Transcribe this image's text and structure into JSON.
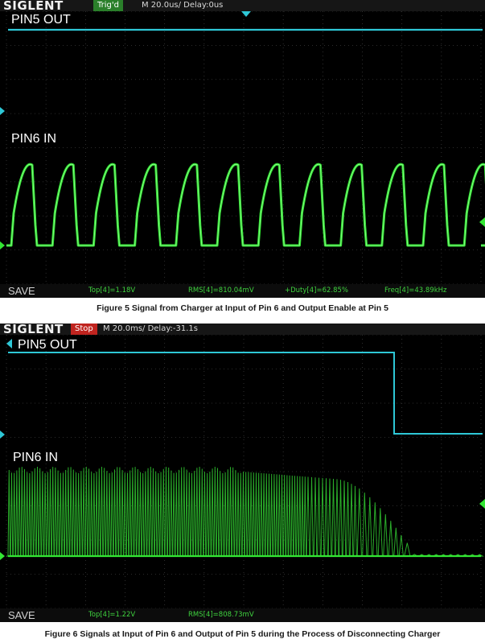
{
  "figure1": {
    "brand": "SIGLENT",
    "status": "Trig'd",
    "timebase": "M 20.0us/  Delay:0us",
    "ch_top_label": "PIN5 OUT",
    "ch_bottom_label": "PIN6 IN",
    "save_label": "SAVE",
    "measurements": {
      "top": "Top[4]=1.18V",
      "rms": "RMS[4]=810.04mV",
      "duty": "+Duty[4]=62.85%",
      "freq": "Freq[4]=43.89kHz"
    },
    "caption": "Figure 5 Signal from Charger at Input of Pin 6 and Output Enable at Pin 5"
  },
  "figure2": {
    "brand": "SIGLENT",
    "status": "Stop",
    "timebase": "M 20.0ms/ Delay:-31.1s",
    "ch_top_label": "PIN5 OUT",
    "ch_bottom_label": "PIN6 IN",
    "save_label": "SAVE",
    "measurements": {
      "top": "Top[4]=1.22V",
      "rms": "RMS[4]=808.73mV"
    },
    "caption": "Figure 6 Signals at Input of Pin 6 and Output of Pin 5 during the Process of Disconnecting Charger"
  },
  "colors": {
    "screen_bg": "#000000",
    "ch3_cyan": "#2ec7d6",
    "ch4_green": "#33e633",
    "grid": "#3a3a3a",
    "measure_text": "#3fd33f"
  }
}
